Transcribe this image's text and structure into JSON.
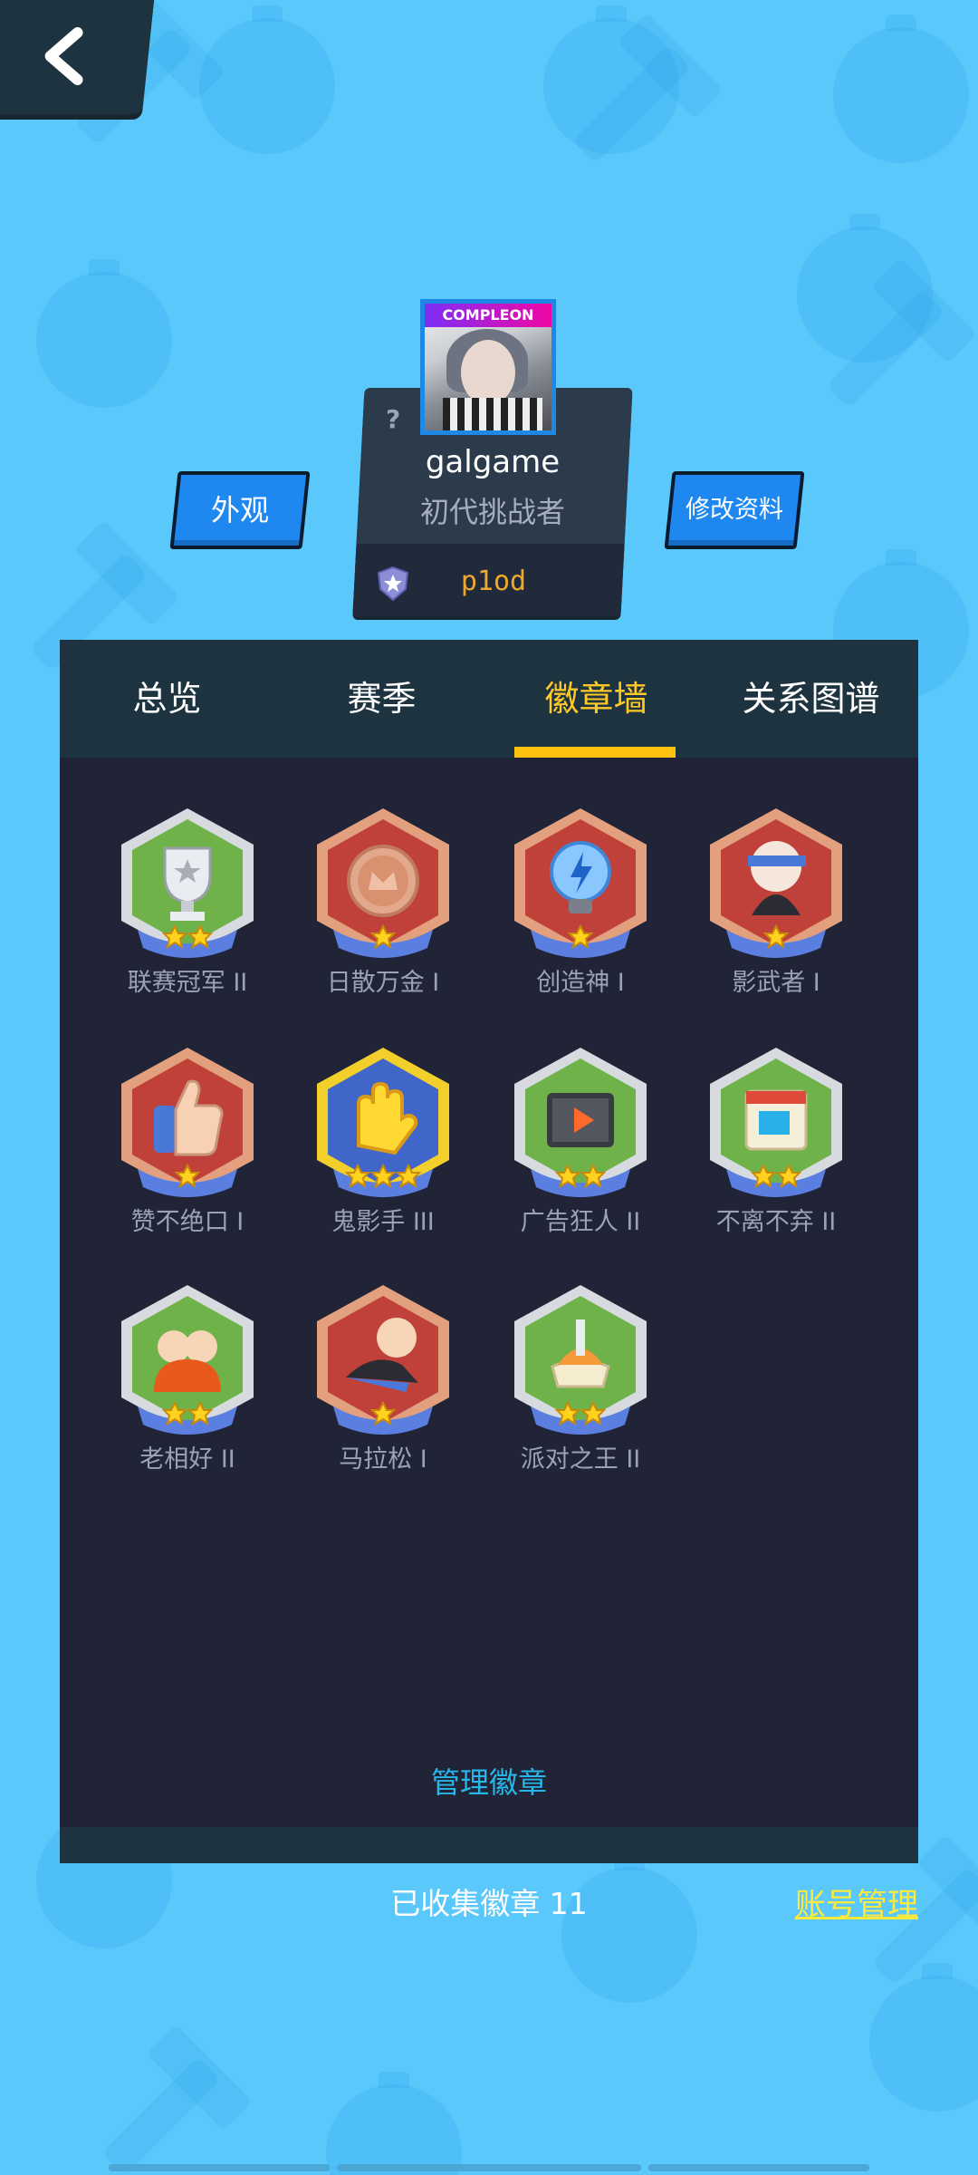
{
  "header": {
    "back_icon": "chevron-left-icon"
  },
  "profile": {
    "avatar_banner_text": "COMPLEON",
    "unknown_mark": "?",
    "username": "galgame",
    "title": "初代挑战者",
    "rank_label": "p1od"
  },
  "buttons": {
    "appearance": "外观",
    "edit_profile": "修改资料"
  },
  "tabs": [
    {
      "label": "总览"
    },
    {
      "label": "赛季"
    },
    {
      "label": "徽章墙"
    },
    {
      "label": "关系图谱"
    }
  ],
  "active_tab": "徽章墙",
  "badges": [
    {
      "name": "联赛冠军 II",
      "icon": "trophy-icon",
      "stars": 2
    },
    {
      "name": "日散万金 I",
      "icon": "coin-crown-icon",
      "stars": 1
    },
    {
      "name": "创造神 I",
      "icon": "lightbulb-icon",
      "stars": 1
    },
    {
      "name": "影武者 I",
      "icon": "ninja-icon",
      "stars": 1
    },
    {
      "name": "赞不绝口 I",
      "icon": "thumbs-up-icon",
      "stars": 1
    },
    {
      "name": "鬼影手 III",
      "icon": "golden-hand-icon",
      "stars": 3
    },
    {
      "name": "广告狂人 II",
      "icon": "film-play-icon",
      "stars": 2
    },
    {
      "name": "不离不弃 II",
      "icon": "calendar-icon",
      "stars": 2
    },
    {
      "name": "老相好 II",
      "icon": "hug-icon",
      "stars": 2
    },
    {
      "name": "马拉松 I",
      "icon": "runner-icon",
      "stars": 1
    },
    {
      "name": "派对之王 II",
      "icon": "party-icon",
      "stars": 2
    }
  ],
  "manage_badges": "管理徽章",
  "collected_text": "已收集徽章 11",
  "account_manage": "账号管理",
  "colors": {
    "background": "#5ac8fb",
    "panel": "#212337",
    "tab_bar": "#1e3340",
    "active_tab": "#ffc927",
    "button": "#1e88f0",
    "link_yellow": "#ffe93b",
    "manage_link": "#28b6e8"
  }
}
